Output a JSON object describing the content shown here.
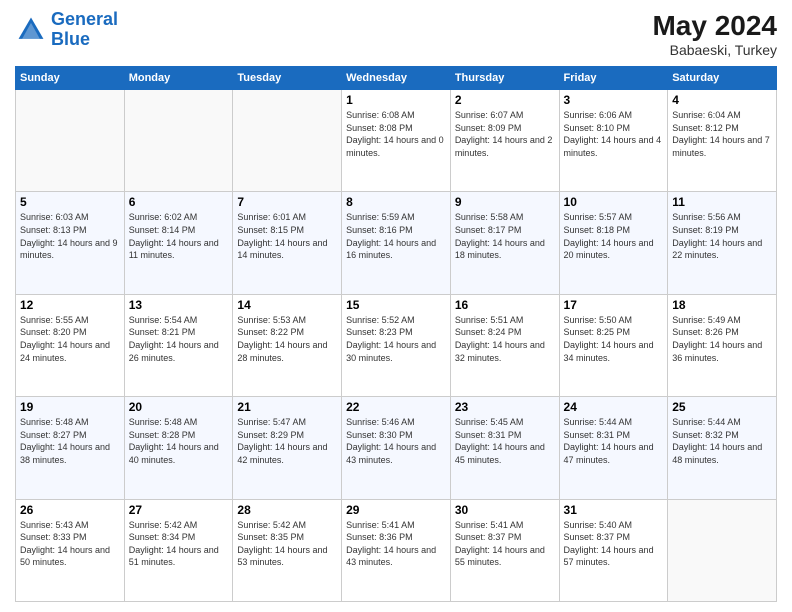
{
  "header": {
    "logo_line1": "General",
    "logo_line2": "Blue",
    "month_year": "May 2024",
    "location": "Babaeski, Turkey"
  },
  "weekdays": [
    "Sunday",
    "Monday",
    "Tuesday",
    "Wednesday",
    "Thursday",
    "Friday",
    "Saturday"
  ],
  "weeks": [
    [
      {
        "day": "",
        "sunrise": "",
        "sunset": "",
        "daylight": ""
      },
      {
        "day": "",
        "sunrise": "",
        "sunset": "",
        "daylight": ""
      },
      {
        "day": "",
        "sunrise": "",
        "sunset": "",
        "daylight": ""
      },
      {
        "day": "1",
        "sunrise": "Sunrise: 6:08 AM",
        "sunset": "Sunset: 8:08 PM",
        "daylight": "Daylight: 14 hours and 0 minutes."
      },
      {
        "day": "2",
        "sunrise": "Sunrise: 6:07 AM",
        "sunset": "Sunset: 8:09 PM",
        "daylight": "Daylight: 14 hours and 2 minutes."
      },
      {
        "day": "3",
        "sunrise": "Sunrise: 6:06 AM",
        "sunset": "Sunset: 8:10 PM",
        "daylight": "Daylight: 14 hours and 4 minutes."
      },
      {
        "day": "4",
        "sunrise": "Sunrise: 6:04 AM",
        "sunset": "Sunset: 8:12 PM",
        "daylight": "Daylight: 14 hours and 7 minutes."
      }
    ],
    [
      {
        "day": "5",
        "sunrise": "Sunrise: 6:03 AM",
        "sunset": "Sunset: 8:13 PM",
        "daylight": "Daylight: 14 hours and 9 minutes."
      },
      {
        "day": "6",
        "sunrise": "Sunrise: 6:02 AM",
        "sunset": "Sunset: 8:14 PM",
        "daylight": "Daylight: 14 hours and 11 minutes."
      },
      {
        "day": "7",
        "sunrise": "Sunrise: 6:01 AM",
        "sunset": "Sunset: 8:15 PM",
        "daylight": "Daylight: 14 hours and 14 minutes."
      },
      {
        "day": "8",
        "sunrise": "Sunrise: 5:59 AM",
        "sunset": "Sunset: 8:16 PM",
        "daylight": "Daylight: 14 hours and 16 minutes."
      },
      {
        "day": "9",
        "sunrise": "Sunrise: 5:58 AM",
        "sunset": "Sunset: 8:17 PM",
        "daylight": "Daylight: 14 hours and 18 minutes."
      },
      {
        "day": "10",
        "sunrise": "Sunrise: 5:57 AM",
        "sunset": "Sunset: 8:18 PM",
        "daylight": "Daylight: 14 hours and 20 minutes."
      },
      {
        "day": "11",
        "sunrise": "Sunrise: 5:56 AM",
        "sunset": "Sunset: 8:19 PM",
        "daylight": "Daylight: 14 hours and 22 minutes."
      }
    ],
    [
      {
        "day": "12",
        "sunrise": "Sunrise: 5:55 AM",
        "sunset": "Sunset: 8:20 PM",
        "daylight": "Daylight: 14 hours and 24 minutes."
      },
      {
        "day": "13",
        "sunrise": "Sunrise: 5:54 AM",
        "sunset": "Sunset: 8:21 PM",
        "daylight": "Daylight: 14 hours and 26 minutes."
      },
      {
        "day": "14",
        "sunrise": "Sunrise: 5:53 AM",
        "sunset": "Sunset: 8:22 PM",
        "daylight": "Daylight: 14 hours and 28 minutes."
      },
      {
        "day": "15",
        "sunrise": "Sunrise: 5:52 AM",
        "sunset": "Sunset: 8:23 PM",
        "daylight": "Daylight: 14 hours and 30 minutes."
      },
      {
        "day": "16",
        "sunrise": "Sunrise: 5:51 AM",
        "sunset": "Sunset: 8:24 PM",
        "daylight": "Daylight: 14 hours and 32 minutes."
      },
      {
        "day": "17",
        "sunrise": "Sunrise: 5:50 AM",
        "sunset": "Sunset: 8:25 PM",
        "daylight": "Daylight: 14 hours and 34 minutes."
      },
      {
        "day": "18",
        "sunrise": "Sunrise: 5:49 AM",
        "sunset": "Sunset: 8:26 PM",
        "daylight": "Daylight: 14 hours and 36 minutes."
      }
    ],
    [
      {
        "day": "19",
        "sunrise": "Sunrise: 5:48 AM",
        "sunset": "Sunset: 8:27 PM",
        "daylight": "Daylight: 14 hours and 38 minutes."
      },
      {
        "day": "20",
        "sunrise": "Sunrise: 5:48 AM",
        "sunset": "Sunset: 8:28 PM",
        "daylight": "Daylight: 14 hours and 40 minutes."
      },
      {
        "day": "21",
        "sunrise": "Sunrise: 5:47 AM",
        "sunset": "Sunset: 8:29 PM",
        "daylight": "Daylight: 14 hours and 42 minutes."
      },
      {
        "day": "22",
        "sunrise": "Sunrise: 5:46 AM",
        "sunset": "Sunset: 8:30 PM",
        "daylight": "Daylight: 14 hours and 43 minutes."
      },
      {
        "day": "23",
        "sunrise": "Sunrise: 5:45 AM",
        "sunset": "Sunset: 8:31 PM",
        "daylight": "Daylight: 14 hours and 45 minutes."
      },
      {
        "day": "24",
        "sunrise": "Sunrise: 5:44 AM",
        "sunset": "Sunset: 8:31 PM",
        "daylight": "Daylight: 14 hours and 47 minutes."
      },
      {
        "day": "25",
        "sunrise": "Sunrise: 5:44 AM",
        "sunset": "Sunset: 8:32 PM",
        "daylight": "Daylight: 14 hours and 48 minutes."
      }
    ],
    [
      {
        "day": "26",
        "sunrise": "Sunrise: 5:43 AM",
        "sunset": "Sunset: 8:33 PM",
        "daylight": "Daylight: 14 hours and 50 minutes."
      },
      {
        "day": "27",
        "sunrise": "Sunrise: 5:42 AM",
        "sunset": "Sunset: 8:34 PM",
        "daylight": "Daylight: 14 hours and 51 minutes."
      },
      {
        "day": "28",
        "sunrise": "Sunrise: 5:42 AM",
        "sunset": "Sunset: 8:35 PM",
        "daylight": "Daylight: 14 hours and 53 minutes."
      },
      {
        "day": "29",
        "sunrise": "Sunrise: 5:41 AM",
        "sunset": "Sunset: 8:36 PM",
        "daylight": "Daylight: 14 hours and 43 minutes."
      },
      {
        "day": "30",
        "sunrise": "Sunrise: 5:41 AM",
        "sunset": "Sunset: 8:37 PM",
        "daylight": "Daylight: 14 hours and 55 minutes."
      },
      {
        "day": "31",
        "sunrise": "Sunrise: 5:40 AM",
        "sunset": "Sunset: 8:37 PM",
        "daylight": "Daylight: 14 hours and 57 minutes."
      },
      {
        "day": "",
        "sunrise": "",
        "sunset": "",
        "daylight": ""
      }
    ]
  ]
}
